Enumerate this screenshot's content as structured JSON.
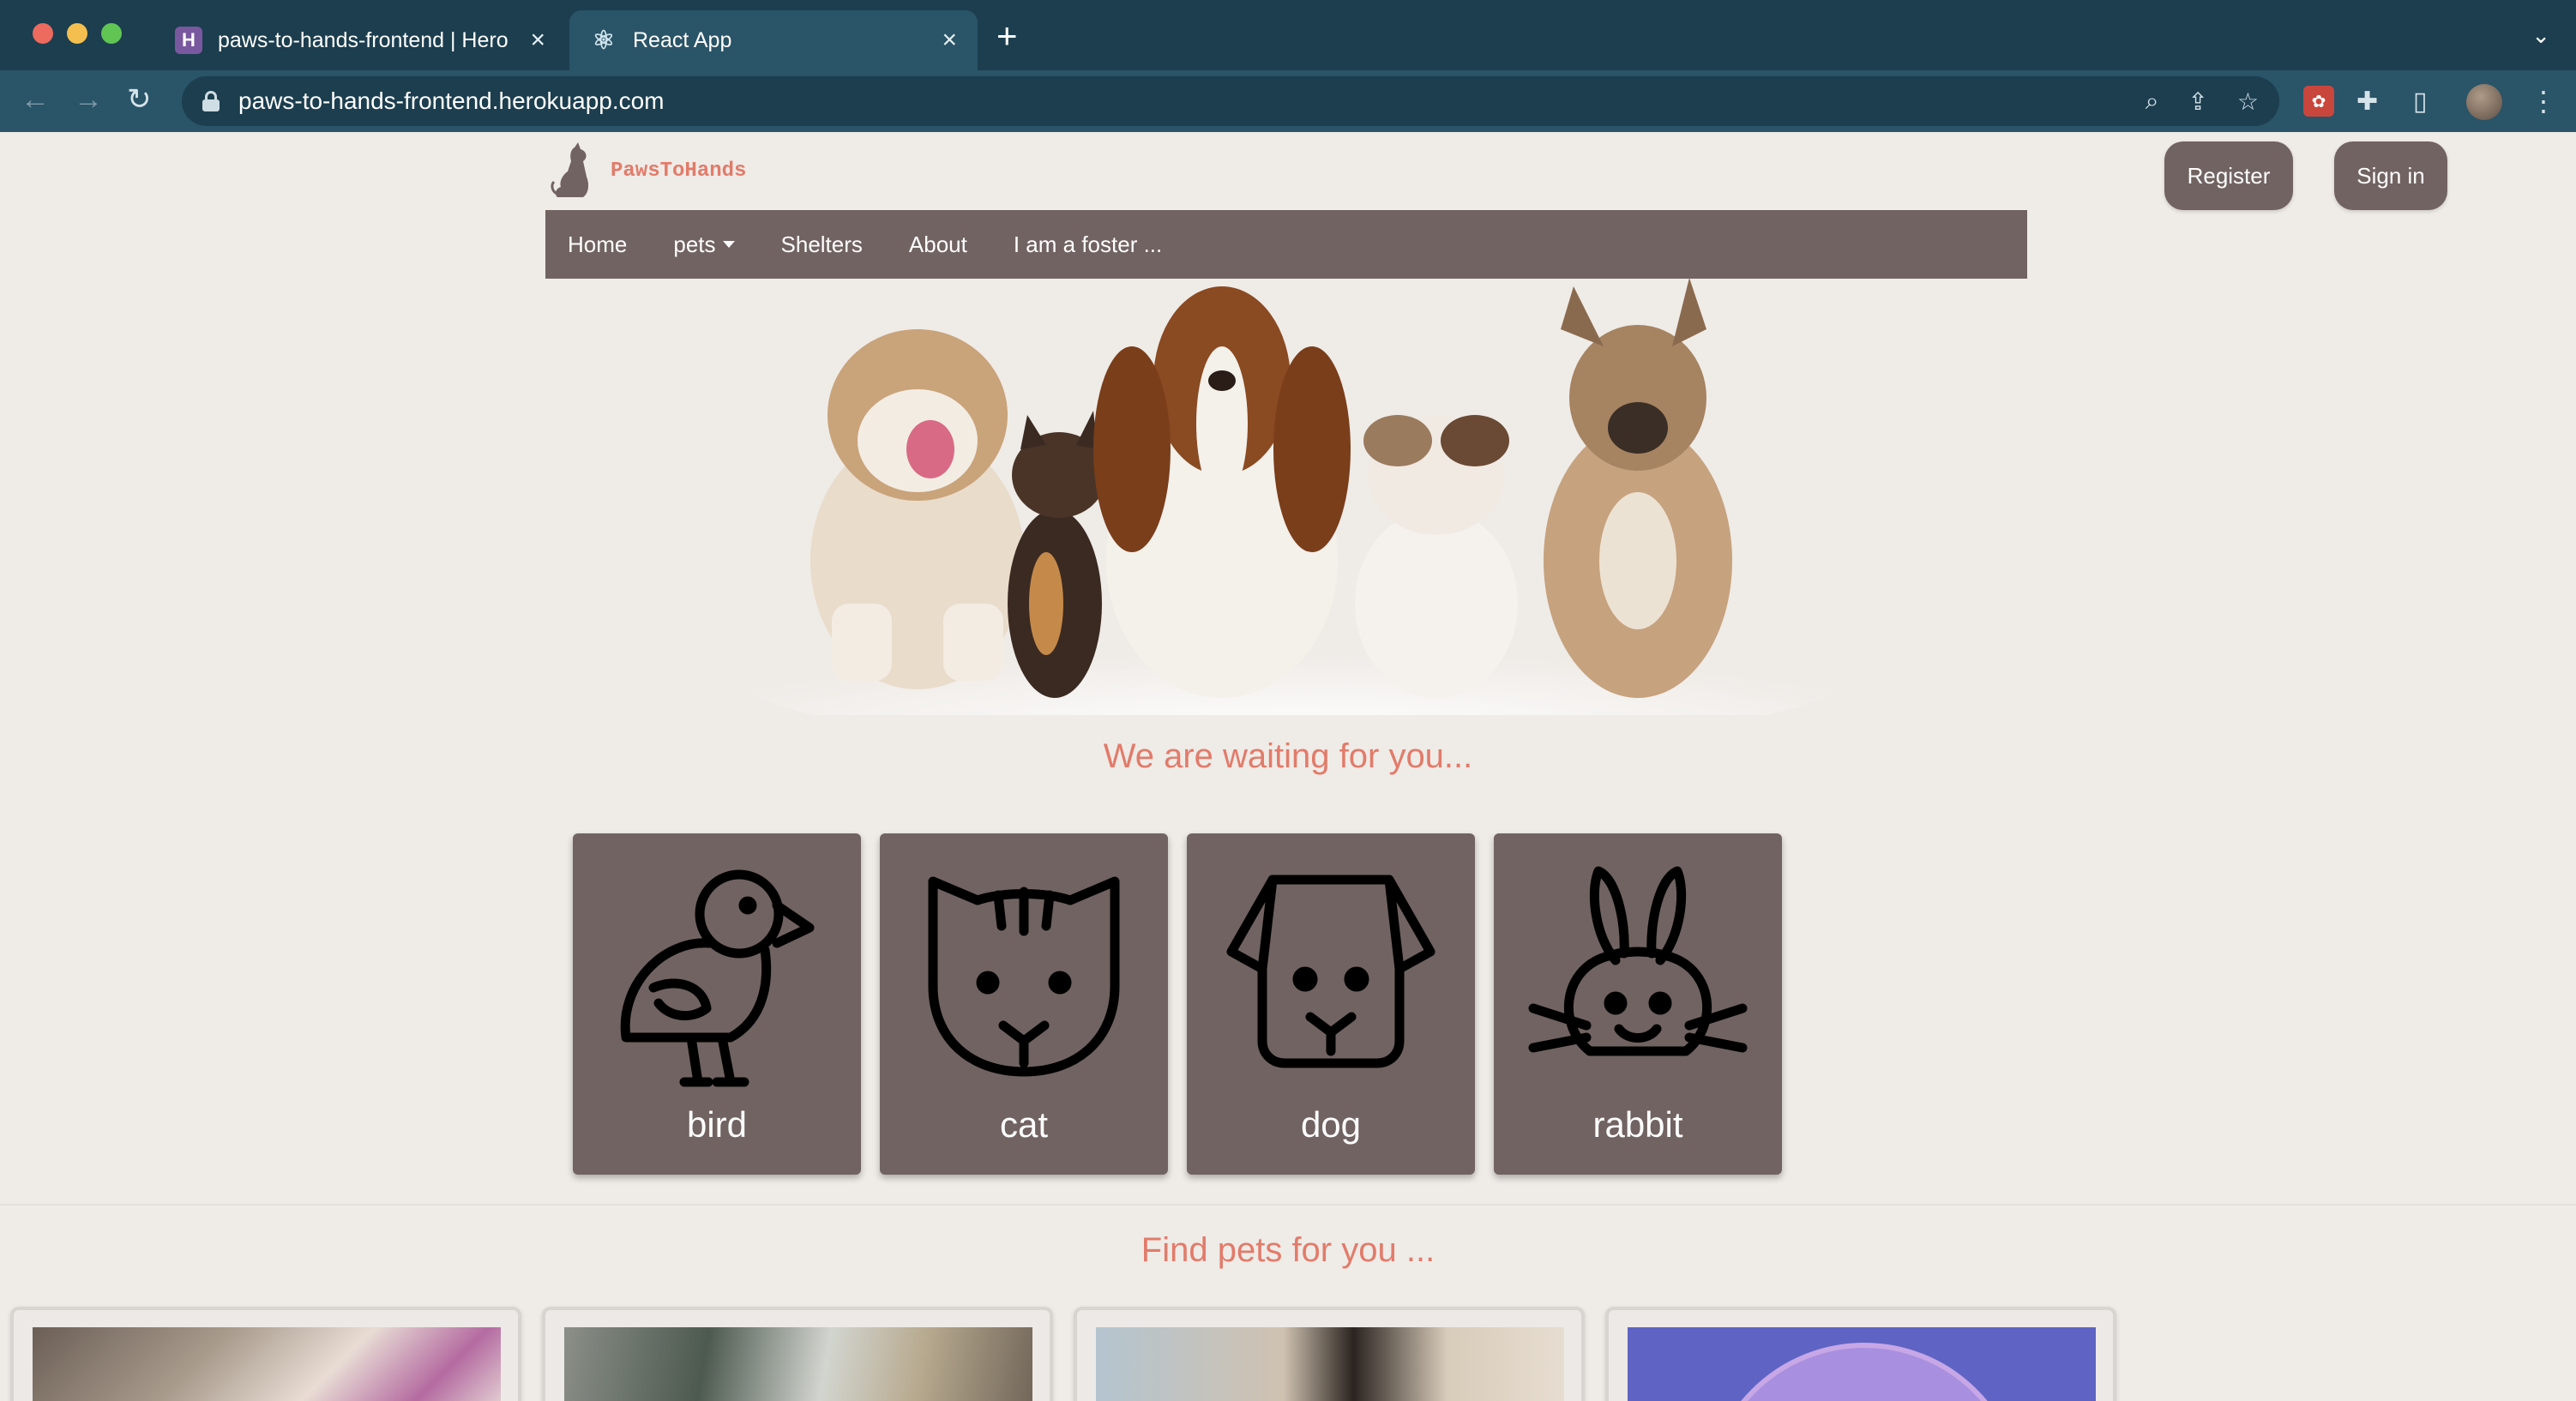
{
  "browser": {
    "tabs": [
      {
        "title": "paws-to-hands-frontend | Hero",
        "favicon": "heroku-icon"
      },
      {
        "title": "React App",
        "favicon": "react-icon"
      }
    ],
    "new_tab": "+",
    "url": "paws-to-hands-frontend.herokuapp.com"
  },
  "site": {
    "logo_text": "PawsToHands",
    "register_label": "Register",
    "signin_label": "Sign in",
    "nav": {
      "home": "Home",
      "pets": "pets",
      "shelters": "Shelters",
      "about": "About",
      "foster": "I am a foster ..."
    },
    "waiting_heading": "We are waiting for you...",
    "categories": [
      {
        "label": "bird",
        "icon": "bird-icon"
      },
      {
        "label": "cat",
        "icon": "cat-icon"
      },
      {
        "label": "dog",
        "icon": "dog-icon"
      },
      {
        "label": "rabbit",
        "icon": "rabbit-icon"
      }
    ],
    "find_heading": "Find pets for you ..."
  },
  "colors": {
    "chrome_dark": "#1c3e4f",
    "chrome_toolbar": "#2a5467",
    "page_bg": "#efebe7",
    "brand_brown": "#716361",
    "accent_salmon": "#e27b6a"
  }
}
